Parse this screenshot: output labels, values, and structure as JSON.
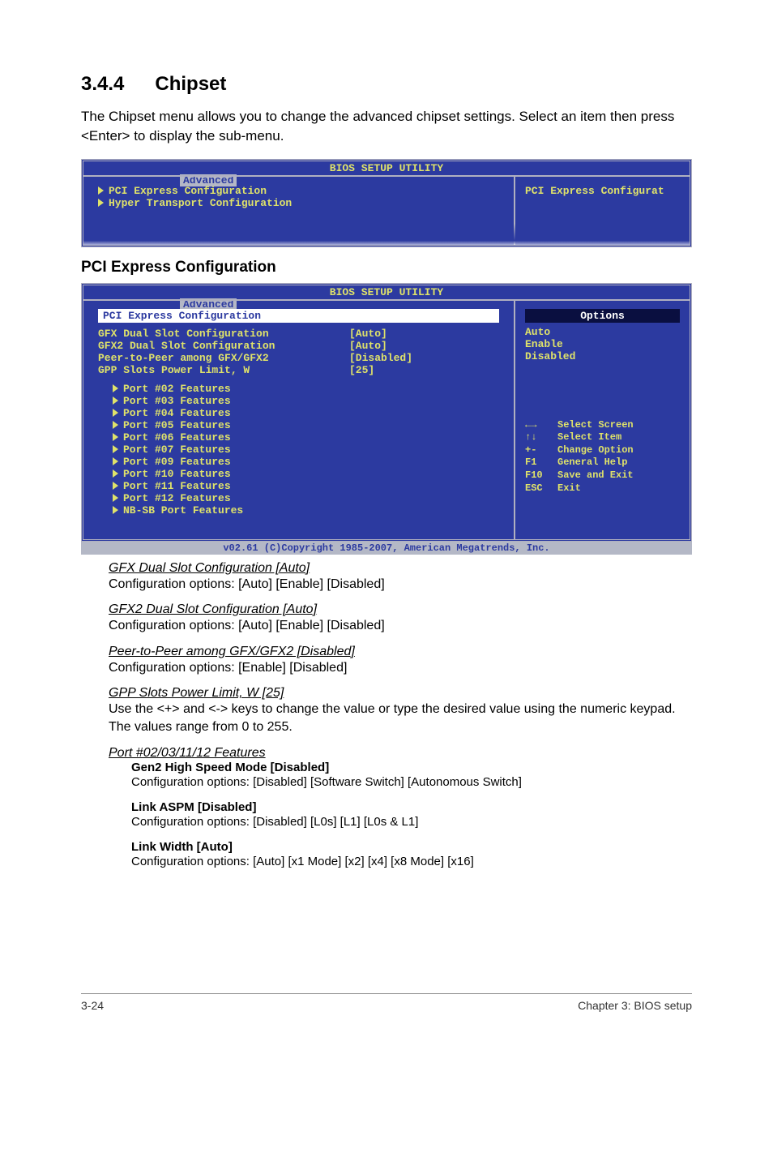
{
  "header": {
    "number": "3.4.4",
    "title": "Chipset",
    "intro": "The Chipset menu allows you to change the advanced chipset settings. Select an item then press <Enter> to display the sub-menu."
  },
  "bios1": {
    "title": "BIOS SETUP UTILITY",
    "tab": "Advanced",
    "menu": [
      "PCI Express Configuration",
      "Hyper Transport Configuration"
    ],
    "help": "PCI Express Configurat"
  },
  "pce_heading": "PCI Express Configuration",
  "bios2": {
    "title": "BIOS SETUP UTILITY",
    "tab": "Advanced",
    "section": "PCI Express Configuration",
    "rows": [
      {
        "label": "GFX Dual Slot Configuration",
        "val": "[Auto]"
      },
      {
        "label": "GFX2 Dual Slot Configuration",
        "val": "[Auto]"
      },
      {
        "label": "Peer-to-Peer among GFX/GFX2",
        "val": "[Disabled]"
      },
      {
        "label": "GPP Slots Power Limit, W",
        "val": "[25]"
      }
    ],
    "subs": [
      "Port #02 Features",
      "Port #03 Features",
      "Port #04 Features",
      "Port #05 Features",
      "Port #06 Features",
      "Port #07 Features",
      "Port #09 Features",
      "Port #10 Features",
      "Port #11 Features",
      "Port #12 Features",
      "NB-SB Port Features"
    ],
    "opts_title": "Options",
    "opts": [
      "Auto",
      "Enable",
      "Disabled"
    ],
    "keys": [
      {
        "k": "←→",
        "d": "Select Screen"
      },
      {
        "k": "↑↓",
        "d": "Select Item"
      },
      {
        "k": "+-",
        "d": "Change Option"
      },
      {
        "k": "F1",
        "d": "General Help"
      },
      {
        "k": "F10",
        "d": "Save and Exit"
      },
      {
        "k": "ESC",
        "d": "Exit"
      }
    ],
    "footer": "v02.61 (C)Copyright 1985-2007, American Megatrends, Inc."
  },
  "items": [
    {
      "t": "GFX Dual Slot Configuration [Auto]",
      "b": "Configuration options: [Auto] [Enable] [Disabled]"
    },
    {
      "t": "GFX2 Dual Slot Configuration [Auto]",
      "b": "Configuration options: [Auto] [Enable] [Disabled]"
    },
    {
      "t": "Peer-to-Peer among GFX/GFX2 [Disabled]",
      "b": "Configuration options: [Enable] [Disabled]"
    },
    {
      "t": "GPP Slots Power Limit, W [25]",
      "b": "Use the <+> and <-> keys to change the value or type the desired value using the numeric keypad. The values range from 0 to 255."
    },
    {
      "t": "Port #02/03/11/12 Features",
      "b": ""
    }
  ],
  "sub2": [
    {
      "t": "Gen2 High Speed Mode [Disabled]",
      "b": "Configuration options: [Disabled] [Software Switch] [Autonomous Switch]"
    },
    {
      "t": "Link ASPM [Disabled]",
      "b": "Configuration options: [Disabled] [L0s] [L1] [L0s & L1]"
    },
    {
      "t": "Link Width [Auto]",
      "b": "Configuration options: [Auto] [x1 Mode] [x2] [x4] [x8 Mode] [x16]"
    }
  ],
  "foot": {
    "l": "3-24",
    "r": "Chapter 3: BIOS setup"
  }
}
